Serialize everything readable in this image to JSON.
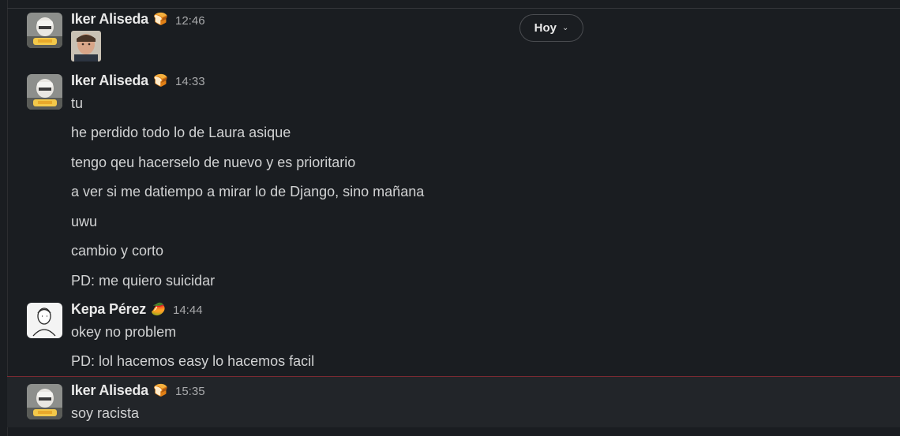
{
  "jump_to_date": {
    "label": "Hoy"
  },
  "messages": [
    {
      "author": "Iker Aliseda",
      "status_emoji": "bread-emoji",
      "time": "12:46",
      "attachment": "profile-photo-thumbnail",
      "lines": []
    },
    {
      "author": "Iker Aliseda",
      "status_emoji": "bread-emoji",
      "time": "14:33",
      "lines": [
        "tu",
        "he perdido todo lo de Laura asique",
        "tengo qeu hacerselo de nuevo y es prioritario",
        "a ver si me datiempo a mirar lo de Django, sino mañana",
        "uwu",
        "cambio y corto",
        "PD: me quiero suicidar"
      ]
    },
    {
      "author": "Kepa Pérez",
      "status_emoji": "mango-emoji",
      "time": "14:44",
      "lines": [
        "okey no problem",
        "PD: lol hacemos easy lo hacemos facil"
      ]
    },
    {
      "author": "Iker Aliseda",
      "status_emoji": "bread-emoji",
      "time": "15:35",
      "lines": [
        "soy racista"
      ]
    }
  ]
}
